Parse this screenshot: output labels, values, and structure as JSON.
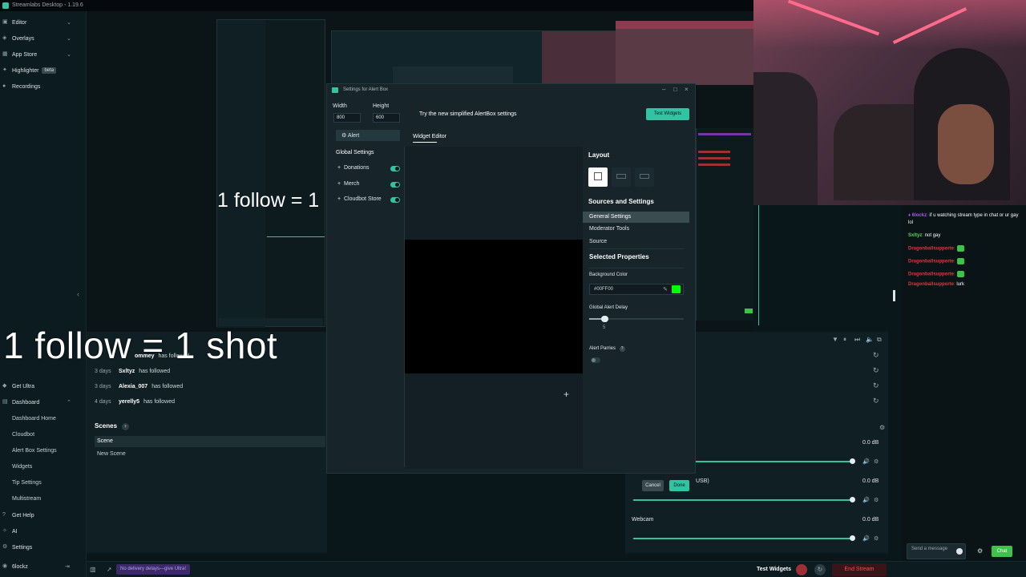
{
  "window": {
    "title": "Streamlabs Desktop - 1.19.6"
  },
  "sidebar": {
    "items": [
      {
        "label": "Editor"
      },
      {
        "label": "Overlays"
      },
      {
        "label": "App Store"
      },
      {
        "label": "Highlighter",
        "badge": "beta"
      },
      {
        "label": "Recordings"
      }
    ],
    "bottom": [
      {
        "label": "Get Ultra"
      },
      {
        "label": "Dashboard"
      }
    ],
    "dashboard_items": [
      "Dashboard Home",
      "Cloudbot",
      "Alert Box Settings",
      "Widgets",
      "Tip Settings",
      "Multistream"
    ],
    "after": [
      {
        "label": "Get Help"
      },
      {
        "label": "AI"
      },
      {
        "label": "Settings"
      }
    ],
    "user": "6lockz"
  },
  "overlay_text": {
    "big": "1 follow = 1 shot",
    "small": "1 follow = 1"
  },
  "recent_events": {
    "header_partial": "ommey",
    "header_action": "has followed",
    "rows": [
      {
        "when": "3 days",
        "who": "Sxltyz",
        "action": "has followed"
      },
      {
        "when": "3 days",
        "who": "Alexia_007",
        "action": "has followed"
      },
      {
        "when": "4 days",
        "who": "yerelly5",
        "action": "has followed"
      }
    ]
  },
  "scenes": {
    "header": "Scenes",
    "items": [
      "Scene",
      "New Scene"
    ]
  },
  "alertbox_modal": {
    "title": "Settings for Alert Box",
    "width_label": "Width",
    "height_label": "Height",
    "width_value": "800",
    "height_value": "600",
    "alert_item": "Alert",
    "global_settings": "Global Settings",
    "sources": [
      {
        "label": "Donations",
        "on": true
      },
      {
        "label": "Merch",
        "on": true
      },
      {
        "label": "Cloudbot Store",
        "on": true
      }
    ],
    "simplified_notice": "Try the new simplified AlertBox settings",
    "test_widgets": "Test Widgets",
    "widget_editor_tab": "Widget Editor",
    "layout_label": "Layout",
    "sources_and_settings": "Sources and Settings",
    "settings_list": [
      "General Settings",
      "Moderator Tools",
      "Source"
    ],
    "selected_properties": "Selected Properties",
    "background_color_label": "Background Color",
    "background_color_value": "#00FF00",
    "global_alert_delay_label": "Global Alert Delay",
    "global_alert_delay_value": "5",
    "alert_parries_label": "Alert Parries",
    "cancel": "Cancel",
    "done": "Done"
  },
  "mixer": {
    "channels": [
      {
        "label": "",
        "db": "0.0 dB"
      },
      {
        "label": "USB)",
        "db": "0.0 dB"
      },
      {
        "label": "Webcam",
        "db": "0.0 dB"
      }
    ]
  },
  "chat": {
    "messages": [
      {
        "user": "6lockz",
        "text": "if u watching stream type in chat or ur gay lol",
        "user_color": "#b84dff"
      },
      {
        "user": "Sxltyz",
        "text": "not gay",
        "user_color": "#5fd35f"
      },
      {
        "user": "Dragonballsupporte",
        "text": "",
        "user_color": "#e0373f",
        "emote": true
      },
      {
        "user": "Dragonballsupporte",
        "text": "",
        "user_color": "#e0373f",
        "emote": true
      },
      {
        "user": "Dragonballsupporte",
        "text": "",
        "user_color": "#e0373f",
        "emote": true
      },
      {
        "user": "Dragonballsupporte",
        "text": "lurk",
        "user_color": "#e0373f"
      }
    ],
    "input_placeholder": "Send a message",
    "chat_button": "Chat"
  },
  "footer": {
    "promo": "No delivery delays—give Ultra!",
    "test_widgets": "Test Widgets",
    "end_stream": "End Stream"
  },
  "colors": {
    "accent": "#31c3a2",
    "chroma": "#00FF00",
    "end_stream": "#e0373f",
    "promo": "#7b4fe0"
  }
}
